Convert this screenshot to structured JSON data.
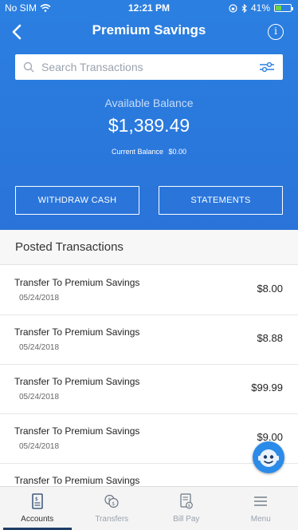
{
  "status_bar": {
    "carrier": "No SIM",
    "time": "12:21 PM",
    "battery": "41%",
    "battery_level": 0.41
  },
  "header": {
    "title": "Premium Savings",
    "back_icon": "chevron-left-icon",
    "info_icon": "info-icon",
    "info_glyph": "i"
  },
  "search": {
    "placeholder": "Search Transactions",
    "value": ""
  },
  "balance": {
    "available_label": "Available Balance",
    "available_value": "$1,389.49",
    "current_label": "Current Balance",
    "current_value": "$0.00"
  },
  "actions": {
    "withdraw_label": "WITHDRAW CASH",
    "statements_label": "STATEMENTS"
  },
  "section": {
    "title": "Posted Transactions"
  },
  "transactions": [
    {
      "name": "Transfer To Premium Savings",
      "date": "05/24/2018",
      "amount": "$8.00"
    },
    {
      "name": "Transfer To Premium Savings",
      "date": "05/24/2018",
      "amount": "$8.88"
    },
    {
      "name": "Transfer To Premium Savings",
      "date": "05/24/2018",
      "amount": "$99.99"
    },
    {
      "name": "Transfer To Premium Savings",
      "date": "05/24/2018",
      "amount": "$9.00"
    },
    {
      "name": "Transfer To Premium Savings",
      "date": "",
      "amount": ""
    }
  ],
  "tabs": [
    {
      "label": "Accounts",
      "icon": "accounts-icon",
      "active": true
    },
    {
      "label": "Transfers",
      "icon": "transfers-icon",
      "active": false
    },
    {
      "label": "Bill Pay",
      "icon": "bill-pay-icon",
      "active": false
    },
    {
      "label": "Menu",
      "icon": "menu-icon",
      "active": false
    }
  ],
  "colors": {
    "brand_blue": "#2b7fe0",
    "tab_active_indicator": "#1e3d66",
    "battery_green": "#6bd34a"
  }
}
